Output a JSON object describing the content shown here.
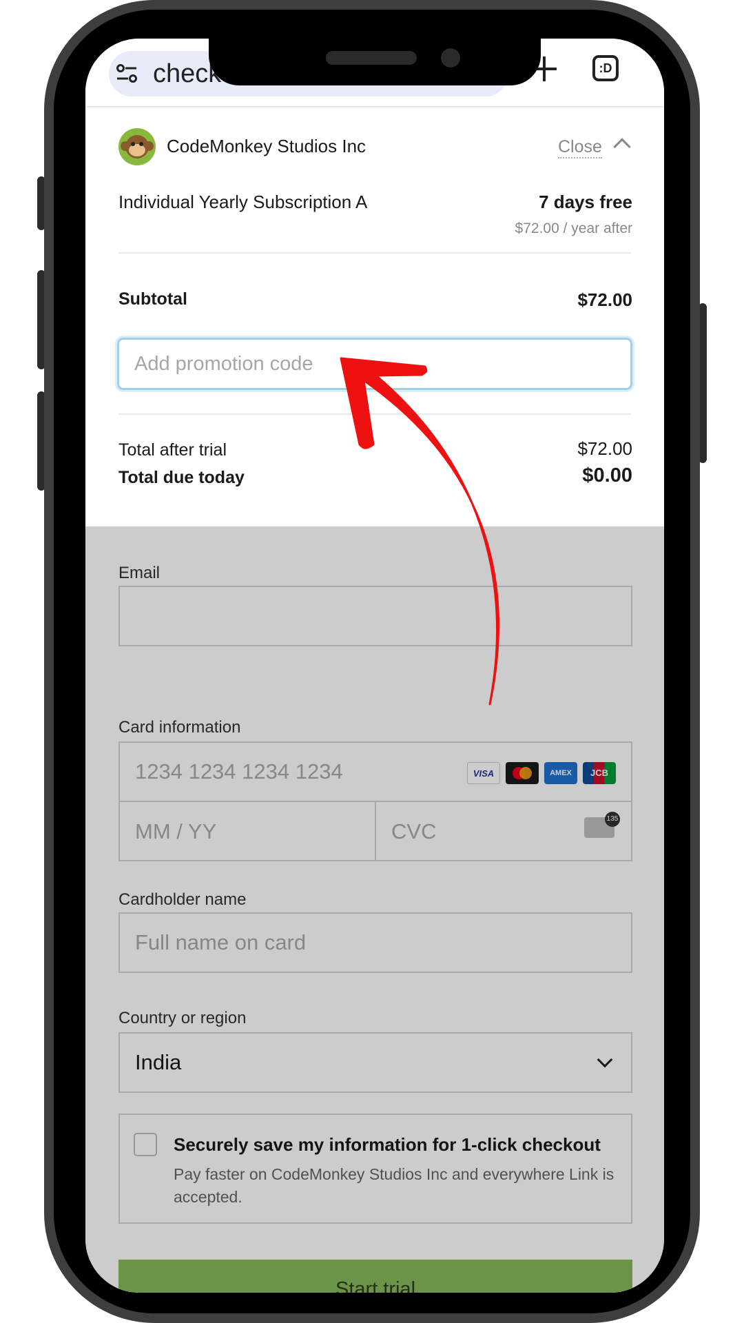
{
  "browser": {
    "url_text": "check"
  },
  "summary": {
    "merchant_name": "CodeMonkey Studios Inc",
    "close_label": "Close",
    "item_name": "Individual Yearly Subscription A",
    "item_price": "7 days free",
    "item_after": "$72.00 / year after",
    "subtotal_label": "Subtotal",
    "subtotal_value": "$72.00",
    "promo_placeholder": "Add promotion code",
    "total_after_trial_label": "Total after trial",
    "total_after_trial_value": "$72.00",
    "total_due_label": "Total due today",
    "total_due_value": "$0.00"
  },
  "form": {
    "email_label": "Email",
    "card_label": "Card information",
    "card_number_placeholder": "1234 1234 1234 1234",
    "card_brands": [
      "VISA",
      "MC",
      "AMEX",
      "JCB"
    ],
    "expiry_placeholder": "MM / YY",
    "cvc_placeholder": "CVC",
    "cvc_icon_text": "135",
    "cardholder_label": "Cardholder name",
    "cardholder_placeholder": "Full name on card",
    "country_label": "Country or region",
    "country_value": "India",
    "save_title": "Securely save my information for 1-click checkout",
    "save_desc": "Pay faster on CodeMonkey Studios Inc and everywhere Link is accepted.",
    "start_button": "Start trial"
  },
  "colors": {
    "accent_green": "#86b95b",
    "focus_blue": "#9fd0e4",
    "annotation_red": "#ee1111"
  }
}
